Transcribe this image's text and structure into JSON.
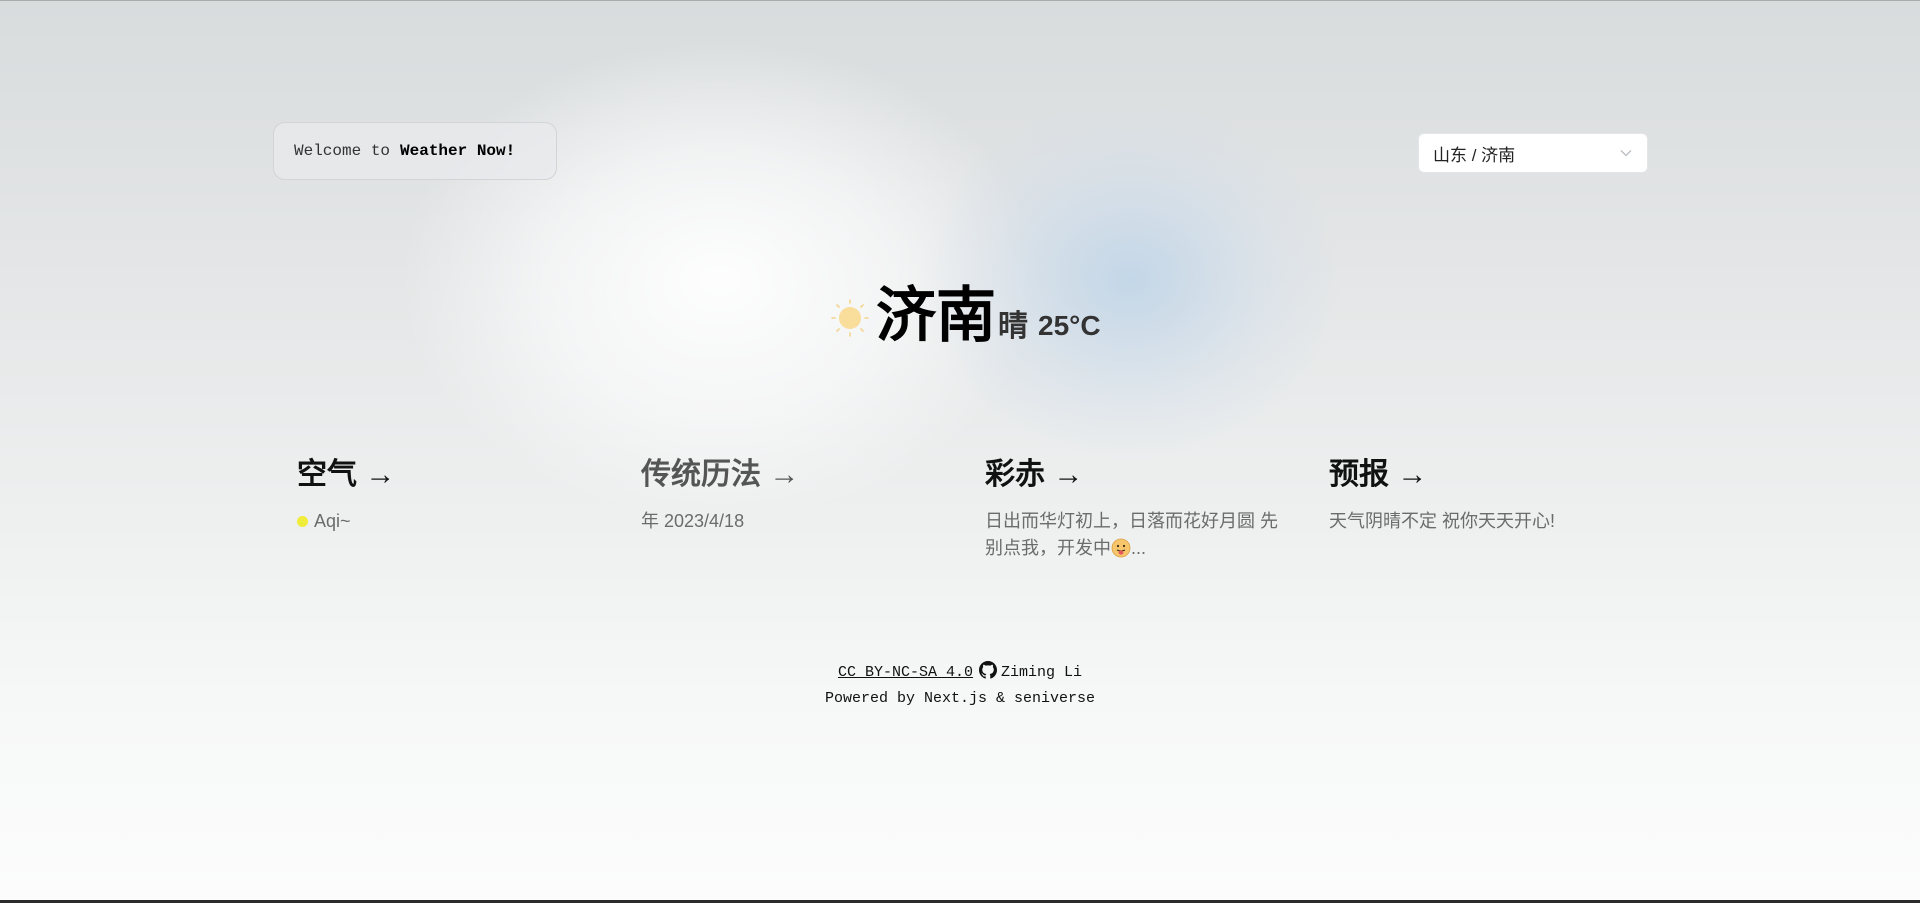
{
  "welcome": {
    "prefix": "Welcome to",
    "app_name": "Weather Now!"
  },
  "location_select": {
    "value": "山东 / 济南"
  },
  "current": {
    "icon": "sun-icon",
    "city": "济南",
    "condition": "晴",
    "temperature": "25°C"
  },
  "cards": [
    {
      "title": "空气 →",
      "indicator": "yellow-dot",
      "text": "Aqi~"
    },
    {
      "title": "传统历法 →",
      "text": "年 2023/4/18"
    },
    {
      "title": "彩赤 →",
      "text": "日出而华灯初上，日落而花好月圆 先别点我，开发中",
      "text_suffix": "..."
    },
    {
      "title": "预报 →",
      "text": "天气阴晴不定  祝你天天开心!"
    }
  ],
  "footer": {
    "license": "CC BY-NC-SA 4.0",
    "author": "Ziming Li",
    "powered": "Powered by Next.js & seniverse"
  },
  "colors": {
    "accent_dot": "#f0ec3a",
    "sun": "#f9dd9a"
  }
}
